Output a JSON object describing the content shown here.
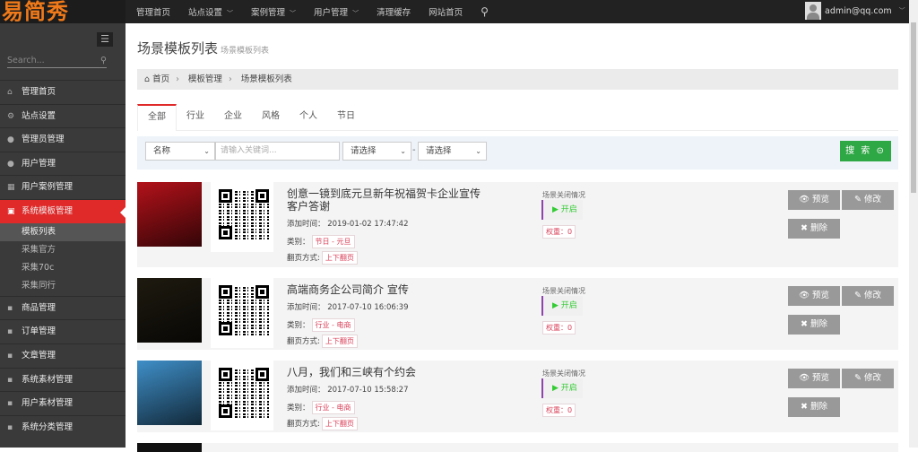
{
  "logo": "易简秀",
  "topnav": [
    {
      "label": "管理首页"
    },
    {
      "label": "站点设置",
      "dropdown": true
    },
    {
      "label": "案例管理",
      "dropdown": true
    },
    {
      "label": "用户管理",
      "dropdown": true
    },
    {
      "label": "清理缓存"
    },
    {
      "label": "网站首页"
    }
  ],
  "user": {
    "email": "admin@qq.com"
  },
  "sidebar": {
    "search_placeholder": "Search...",
    "items": [
      {
        "label": "管理首页",
        "icon": "home"
      },
      {
        "label": "站点设置",
        "icon": "gears"
      },
      {
        "label": "管理员管理",
        "icon": "user"
      },
      {
        "label": "用户管理",
        "icon": "user"
      },
      {
        "label": "用户案例管理",
        "icon": "table"
      },
      {
        "label": "系统模板管理",
        "icon": "briefcase",
        "active": true
      }
    ],
    "subitems": [
      {
        "label": "模板列表",
        "current": true
      },
      {
        "label": "采集官方"
      },
      {
        "label": "采集70c"
      },
      {
        "label": "采集同行"
      }
    ],
    "items2": [
      {
        "label": "商品管理"
      },
      {
        "label": "订单管理"
      },
      {
        "label": "文章管理"
      },
      {
        "label": "系统素材管理"
      },
      {
        "label": "用户素材管理"
      },
      {
        "label": "系统分类管理"
      }
    ]
  },
  "page": {
    "title": "场景模板列表",
    "subtitle": "场景模板列表"
  },
  "breadcrumb": [
    "首页",
    "模板管理",
    "场景模板列表"
  ],
  "tabs": [
    "全部",
    "行业",
    "企业",
    "风格",
    "个人",
    "节日"
  ],
  "filter": {
    "field": "名称",
    "keyword_placeholder": "请输入关键词...",
    "select1": "请选择",
    "select2": "请选择",
    "search_label": "搜 索"
  },
  "labels": {
    "added": "添加时间：",
    "category": "类别：",
    "flip": "翻页方式:",
    "status": "场景关闭情况",
    "preview": "预览",
    "edit": "修改",
    "delete": "删除"
  },
  "templates": [
    {
      "title": "创意一镜到底元旦新年祝福贺卡企业宣传客户答谢",
      "time": "2019-01-02 17:47:42",
      "category": "节日 - 元旦",
      "flip": "上下翻页",
      "status": "开启",
      "weight": "权重：0",
      "thumb_color": "#b3121a"
    },
    {
      "title": "高端商务企公司简介 宣传",
      "time": "2017-07-10 16:06:39",
      "category": "行业 - 电商",
      "flip": "上下翻页",
      "status": "开启",
      "weight": "权重：0",
      "thumb_color": "#1e1a10"
    },
    {
      "title": "八月，我们和三峡有个约会",
      "time": "2017-07-10 15:58:27",
      "category": "行业 - 电商",
      "flip": "上下翻页",
      "status": "开启",
      "weight": "权重：0",
      "thumb_color": "#3f8fc8"
    }
  ]
}
